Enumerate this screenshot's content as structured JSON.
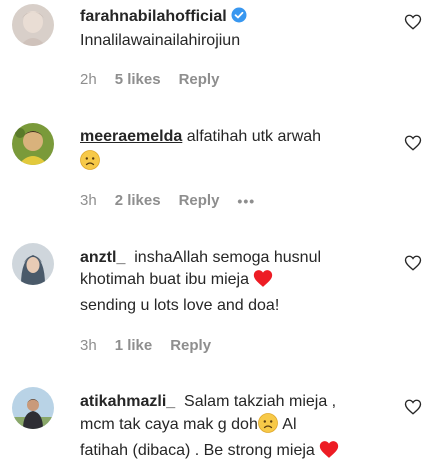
{
  "comments": [
    {
      "username": "farahnabilahofficial",
      "verified": true,
      "text": "Innalilawainailahirojiun",
      "time": "2h",
      "likes": "5 likes",
      "reply": "Reply"
    },
    {
      "username": "meeraemelda",
      "text": "alfatihah utk arwah",
      "time": "3h",
      "likes": "2 likes",
      "reply": "Reply",
      "more": "•••"
    },
    {
      "username": "anztl_",
      "text_line1": "inshaAllah semoga husnul",
      "text_line2": "khotimah buat ibu mieja",
      "text_line3": "sending u lots love and doa!",
      "time": "3h",
      "likes": "1 like",
      "reply": "Reply"
    },
    {
      "username": "atikahmazli_",
      "text_line1": "Salam takziah mieja ,",
      "text_line2": "mcm tak caya mak g doh",
      "text_line2b": "Al",
      "text_line3": "fatihah (dibaca) . Be strong mieja"
    }
  ],
  "colors": {
    "text": "#262626",
    "meta": "#8e8e8e",
    "verified": "#3897f0",
    "heart_red": "#ed1c24",
    "emoji_yellow": "#f7c948"
  },
  "icons": {
    "like": "heart-outline-icon",
    "verified": "verified-badge-icon",
    "sad": "sad-face-emoji",
    "heart": "red-heart-emoji"
  }
}
